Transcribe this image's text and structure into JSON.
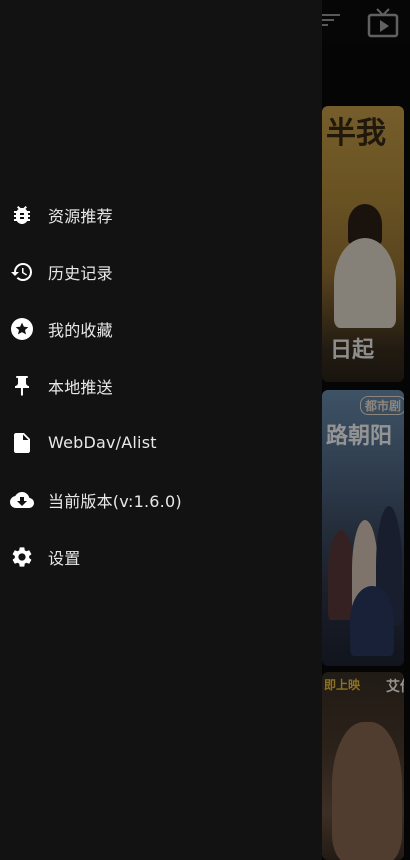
{
  "drawer": {
    "items": [
      {
        "label": "资源推荐",
        "icon": "bug-icon"
      },
      {
        "label": "历史记录",
        "icon": "history-icon"
      },
      {
        "label": "我的收藏",
        "icon": "star-icon"
      },
      {
        "label": "本地推送",
        "icon": "pin-icon"
      },
      {
        "label": "WebDav/Alist",
        "icon": "file-icon"
      },
      {
        "label": "当前版本(v:1.6.0)",
        "icon": "cloud-download-icon"
      },
      {
        "label": "设置",
        "icon": "settings-icon"
      }
    ]
  },
  "background": {
    "poster_1": {
      "title_fragment": "半我",
      "bottom_text": "日起"
    },
    "poster_2": {
      "badge": "都市剧",
      "title_fragment": "路朝阳"
    },
    "poster_3": {
      "tag": "即上映",
      "side_text": "艾伦"
    }
  },
  "colors": {
    "drawer_background": "#121212",
    "text": "#e8e8e8",
    "icon": "#ffffff"
  }
}
